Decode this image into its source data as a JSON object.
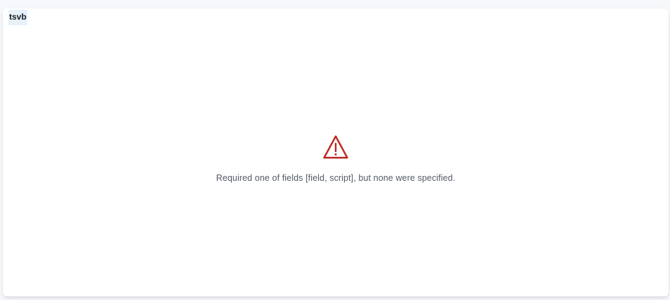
{
  "panel": {
    "title": "tsvb"
  },
  "error": {
    "icon": "warning-icon",
    "icon_color": "#bd271e",
    "message": "Required one of fields [field, script], but none were specified."
  }
}
